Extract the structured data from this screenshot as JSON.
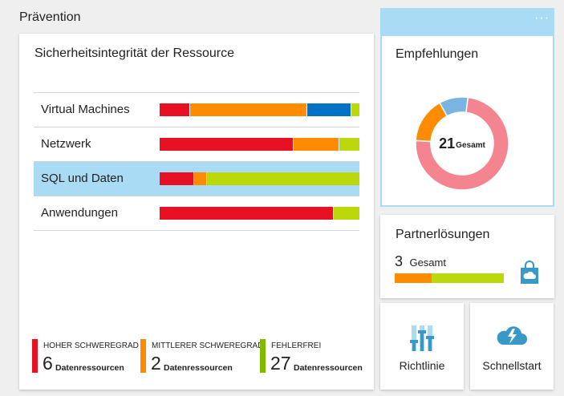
{
  "section": {
    "title": "Prävention"
  },
  "health": {
    "title": "Sicherheitsintegrität der Ressource",
    "rows": [
      {
        "label": "Virtual Machines",
        "selected": false,
        "segments": [
          {
            "color": "#e81123",
            "fraction": 0.15
          },
          {
            "color": "#ff8c00",
            "fraction": 0.59
          },
          {
            "color": "#0072c6",
            "fraction": 0.22
          },
          {
            "color": "#bad80a",
            "fraction": 0.04
          }
        ]
      },
      {
        "label": "Netzwerk",
        "selected": false,
        "segments": [
          {
            "color": "#e81123",
            "fraction": 0.67
          },
          {
            "color": "#ff8c00",
            "fraction": 0.23
          },
          {
            "color": "#bad80a",
            "fraction": 0.1
          }
        ]
      },
      {
        "label": "SQL und Daten",
        "selected": true,
        "segments": [
          {
            "color": "#e81123",
            "fraction": 0.17
          },
          {
            "color": "#ff8c00",
            "fraction": 0.06
          },
          {
            "color": "#bad80a",
            "fraction": 0.77
          }
        ]
      },
      {
        "label": "Anwendungen",
        "selected": false,
        "segments": [
          {
            "color": "#e81123",
            "fraction": 0.87
          },
          {
            "color": "#bad80a",
            "fraction": 0.13
          }
        ]
      }
    ],
    "legend": [
      {
        "label": "HOHER SCHWEREGRAD",
        "value": "6",
        "unit": "Datenressourcen",
        "color": "#e81123"
      },
      {
        "label": "MITTLERER SCHWEREGRAD",
        "value": "2",
        "unit": "Datenressourcen",
        "color": "#ff8c00"
      },
      {
        "label": "FEHLERFREI",
        "value": "27",
        "unit": "Datenressourcen",
        "color": "#7fba00"
      }
    ]
  },
  "recommendations": {
    "title": "Empfehlungen",
    "more": "···",
    "total": "21",
    "total_unit": "Gesamt",
    "donut": [
      {
        "color": "#f4848f",
        "fraction": 0.74
      },
      {
        "color": "#ff8c00",
        "fraction": 0.16
      },
      {
        "color": "#7ab4e0",
        "fraction": 0.1
      }
    ]
  },
  "partner": {
    "title": "Partnerlösungen",
    "count": "3",
    "count_unit": "Gesamt",
    "segments": [
      {
        "color": "#ff8c00",
        "fraction": 0.34
      },
      {
        "color": "#bad80a",
        "fraction": 0.66
      }
    ],
    "icon": "shopping-bag-cloud-icon"
  },
  "policy": {
    "label": "Richtlinie",
    "icon": "policy-sliders-icon"
  },
  "quickstart": {
    "label": "Schnellstart",
    "icon": "cloud-lightning-icon"
  }
}
